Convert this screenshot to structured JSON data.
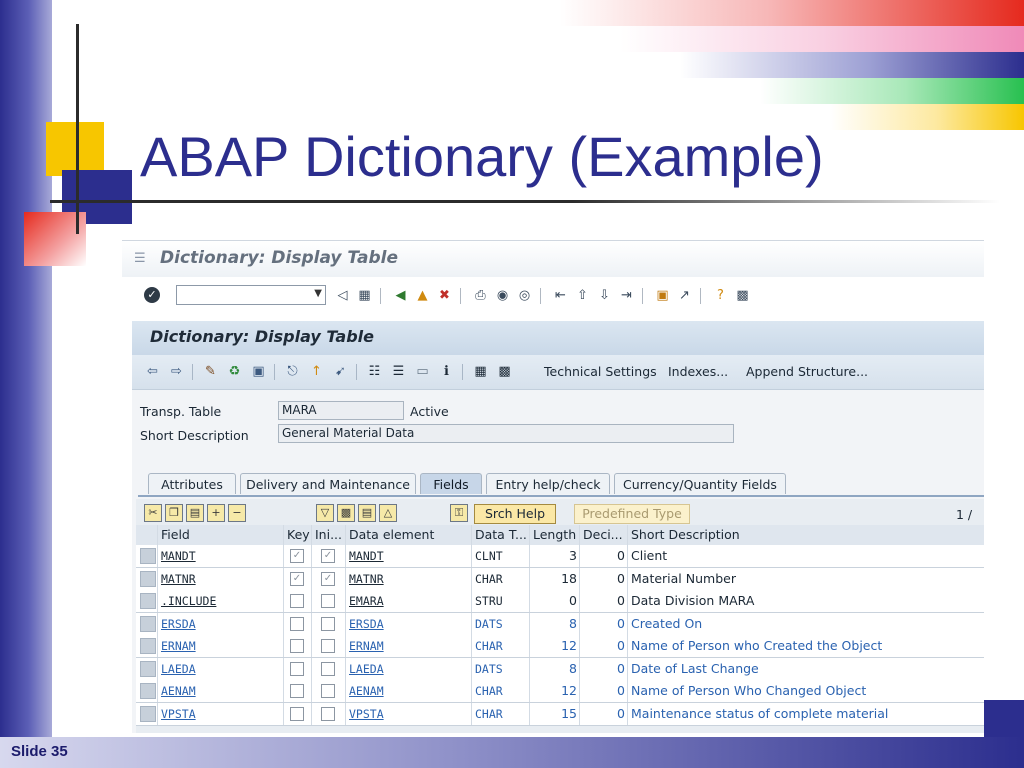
{
  "slide": {
    "title": "ABAP Dictionary (Example)",
    "slide_number": "Slide 35",
    "colors": {
      "title": "#2c2e8e",
      "band_blue": "#2c2e8e",
      "yellow": "#f7c600",
      "red": "#e52a1e",
      "green": "#28c050",
      "pink": "#f08ab8"
    }
  },
  "window": {
    "title": "Dictionary: Display Table",
    "menu_icon": "menu-icon"
  },
  "toolbar": {
    "command_field_value": "",
    "icons": [
      "enter-icon",
      "back-icon",
      "save-icon",
      "back-green-icon",
      "exit-icon",
      "cancel-icon",
      "print-icon",
      "find-icon",
      "find-next-icon",
      "first-page-icon",
      "prev-page-icon",
      "next-page-icon",
      "last-page-icon",
      "create-session-icon",
      "shortcut-icon",
      "help-icon",
      "layout-icon"
    ]
  },
  "panel": {
    "title": "Dictionary: Display Table",
    "buttons": {
      "technical_settings": "Technical Settings",
      "indexes": "Indexes...",
      "append_structure": "Append Structure..."
    }
  },
  "header_fields": {
    "transp_table_label": "Transp. Table",
    "transp_table_value": "MARA",
    "status": "Active",
    "short_description_label": "Short Description",
    "short_description_value": "General Material Data"
  },
  "tabs": [
    {
      "label": "Attributes",
      "active": false
    },
    {
      "label": "Delivery and Maintenance",
      "active": false
    },
    {
      "label": "Fields",
      "active": true
    },
    {
      "label": "Entry help/check",
      "active": false
    },
    {
      "label": "Currency/Quantity Fields",
      "active": false
    }
  ],
  "table_controls": {
    "srch_help": "Srch Help",
    "predefined_type": "Predefined Type",
    "page_indicator": "1 /"
  },
  "fields_table": {
    "columns": [
      "Field",
      "Key",
      "Ini...",
      "Data element",
      "Data T...",
      "Length",
      "Deci...",
      "Short Description"
    ],
    "rows": [
      {
        "field": "MANDT",
        "key": true,
        "initial": true,
        "data_element": "MANDT",
        "data_type": "CLNT",
        "length": "3",
        "decimals": "0",
        "description": "Client",
        "blue": false
      },
      {
        "field": "MATNR",
        "key": true,
        "initial": true,
        "data_element": "MATNR",
        "data_type": "CHAR",
        "length": "18",
        "decimals": "0",
        "description": "Material Number",
        "blue": false
      },
      {
        "field": ".INCLUDE",
        "key": false,
        "initial": false,
        "data_element": "EMARA",
        "data_type": "STRU",
        "length": "0",
        "decimals": "0",
        "description": "Data Division MARA",
        "blue": false
      },
      {
        "field": "ERSDA",
        "key": false,
        "initial": false,
        "data_element": "ERSDA",
        "data_type": "DATS",
        "length": "8",
        "decimals": "0",
        "description": "Created On",
        "blue": true
      },
      {
        "field": "ERNAM",
        "key": false,
        "initial": false,
        "data_element": "ERNAM",
        "data_type": "CHAR",
        "length": "12",
        "decimals": "0",
        "description": "Name of Person who Created the Object",
        "blue": true
      },
      {
        "field": "LAEDA",
        "key": false,
        "initial": false,
        "data_element": "LAEDA",
        "data_type": "DATS",
        "length": "8",
        "decimals": "0",
        "description": "Date of Last Change",
        "blue": true
      },
      {
        "field": "AENAM",
        "key": false,
        "initial": false,
        "data_element": "AENAM",
        "data_type": "CHAR",
        "length": "12",
        "decimals": "0",
        "description": "Name of Person Who Changed Object",
        "blue": true
      },
      {
        "field": "VPSTA",
        "key": false,
        "initial": false,
        "data_element": "VPSTA",
        "data_type": "CHAR",
        "length": "15",
        "decimals": "0",
        "description": "Maintenance status of complete material",
        "blue": true
      }
    ]
  }
}
